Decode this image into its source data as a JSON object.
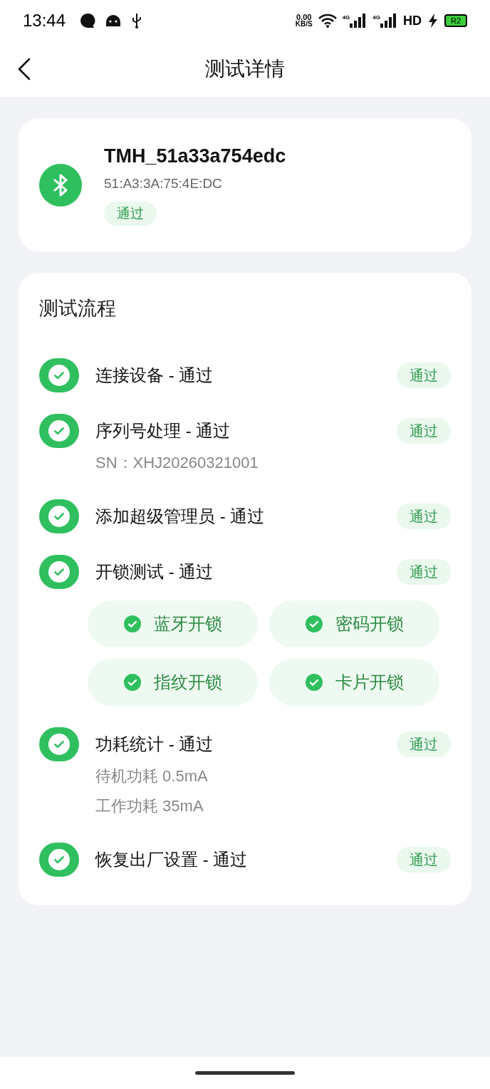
{
  "status_bar": {
    "time": "13:44",
    "speed_value": "0.00",
    "speed_unit": "KB/S",
    "network_1": "4G",
    "network_2": "4G",
    "hd": "HD",
    "battery": "R2"
  },
  "header": {
    "title": "测试详情"
  },
  "device": {
    "name": "TMH_51a33a754edc",
    "mac": "51:A3:3A:75:4E:DC",
    "status": "通过",
    "passed": true
  },
  "flow": {
    "title": "测试流程",
    "steps": [
      {
        "title": "连接设备 - 通过",
        "badge": "通过",
        "passed": true
      },
      {
        "title": "序列号处理 - 通过",
        "badge": "通过",
        "passed": true,
        "details": [
          "SN：XHJ20260321001"
        ]
      },
      {
        "title": "添加超级管理员 - 通过",
        "badge": "通过",
        "passed": true
      },
      {
        "title": "开锁测试 - 通过",
        "badge": "通过",
        "passed": true,
        "results": [
          {
            "label": "蓝牙开锁",
            "passed": true
          },
          {
            "label": "密码开锁",
            "passed": true
          },
          {
            "label": "指纹开锁",
            "passed": true
          },
          {
            "label": "卡片开锁",
            "passed": true
          }
        ]
      },
      {
        "title": "功耗统计 - 通过",
        "badge": "通过",
        "passed": true,
        "details": [
          "待机功耗 0.5mA",
          "工作功耗 35mA"
        ]
      },
      {
        "title": "恢复出厂设置 - 通过",
        "badge": "通过",
        "passed": true
      }
    ]
  }
}
